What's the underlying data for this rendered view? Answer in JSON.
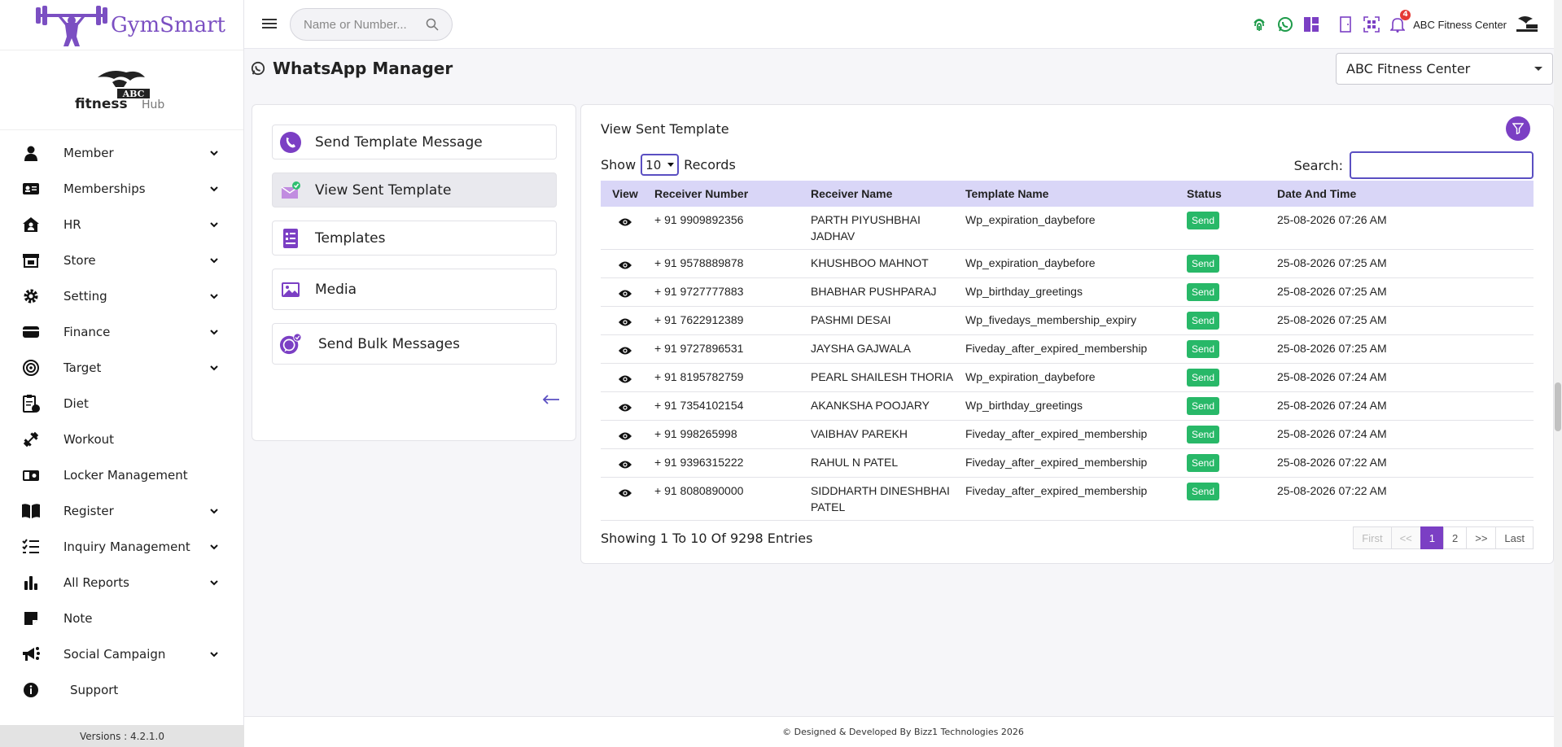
{
  "brand": {
    "name": "GymSmart",
    "gym_logo_text": "ABC fitness Hub"
  },
  "sidebar": {
    "items": [
      {
        "label": "Member",
        "icon": "user-icon",
        "has_children": true
      },
      {
        "label": "Memberships",
        "icon": "id-card-icon",
        "has_children": true
      },
      {
        "label": "HR",
        "icon": "house-user-icon",
        "has_children": true
      },
      {
        "label": "Store",
        "icon": "store-icon",
        "has_children": true
      },
      {
        "label": "Setting",
        "icon": "gear-icon",
        "has_children": true
      },
      {
        "label": "Finance",
        "icon": "credit-card-icon",
        "has_children": true
      },
      {
        "label": "Target",
        "icon": "target-icon",
        "has_children": true
      },
      {
        "label": "Diet",
        "icon": "diet-clipboard-icon",
        "has_children": false
      },
      {
        "label": "Workout",
        "icon": "dumbbell-icon",
        "has_children": false
      },
      {
        "label": "Locker Management",
        "icon": "locker-icon",
        "has_children": false
      },
      {
        "label": "Register",
        "icon": "book-icon",
        "has_children": true
      },
      {
        "label": "Inquiry Management",
        "icon": "checklist-icon",
        "has_children": true
      },
      {
        "label": "All Reports",
        "icon": "bar-chart-icon",
        "has_children": true
      },
      {
        "label": "Note",
        "icon": "note-icon",
        "has_children": false
      },
      {
        "label": "Social Campaign",
        "icon": "megaphone-icon",
        "has_children": true
      },
      {
        "label": "Support",
        "icon": "info-icon",
        "has_children": false
      }
    ],
    "version": "Versions : 4.2.1.0"
  },
  "topbar": {
    "search_placeholder": "Name or Number...",
    "notification_count": "4",
    "gym_name": "ABC Fitness Center"
  },
  "page": {
    "title": "WhatsApp Manager",
    "center_select": "ABC Fitness Center"
  },
  "left_menu": {
    "items": [
      {
        "label": "Send Template Message",
        "icon": "whatsapp-phone-icon"
      },
      {
        "label": "View Sent Template",
        "icon": "envelope-check-icon",
        "active": true
      },
      {
        "label": "Templates",
        "icon": "document-list-icon"
      },
      {
        "label": "Media",
        "icon": "image-icon"
      },
      {
        "label": "Send Bulk Messages",
        "icon": "bulk-whatsapp-icon"
      }
    ]
  },
  "table_panel": {
    "title": "View Sent Template",
    "show_label": "Show",
    "show_value": "10",
    "records_label": "Records",
    "search_label": "Search:",
    "search_value": "",
    "columns": [
      "View",
      "Receiver Number",
      "Receiver Name",
      "Template Name",
      "Status",
      "Date And Time"
    ],
    "rows": [
      {
        "number": "+ 91 9909892356",
        "name": "PARTH PIYUSHBHAI JADHAV",
        "template": "Wp_expiration_daybefore",
        "status": "Send",
        "datetime": "25-08-2026 07:26 AM"
      },
      {
        "number": "+ 91 9578889878",
        "name": "KHUSHBOO MAHNOT",
        "template": "Wp_expiration_daybefore",
        "status": "Send",
        "datetime": "25-08-2026 07:25 AM"
      },
      {
        "number": "+ 91 9727777883",
        "name": "BHABHAR PUSHPARAJ",
        "template": "Wp_birthday_greetings",
        "status": "Send",
        "datetime": "25-08-2026 07:25 AM"
      },
      {
        "number": "+ 91 7622912389",
        "name": "PASHMI DESAI",
        "template": "Wp_fivedays_membership_expiry",
        "status": "Send",
        "datetime": "25-08-2026 07:25 AM"
      },
      {
        "number": "+ 91 9727896531",
        "name": "JAYSHA GAJWALA",
        "template": "Fiveday_after_expired_membership",
        "status": "Send",
        "datetime": "25-08-2026 07:25 AM"
      },
      {
        "number": "+ 91 8195782759",
        "name": "PEARL SHAILESH THORIA",
        "template": "Wp_expiration_daybefore",
        "status": "Send",
        "datetime": "25-08-2026 07:24 AM"
      },
      {
        "number": "+ 91 7354102154",
        "name": "AKANKSHA POOJARY",
        "template": "Wp_birthday_greetings",
        "status": "Send",
        "datetime": "25-08-2026 07:24 AM"
      },
      {
        "number": "+ 91 998265998",
        "name": "VAIBHAV PAREKH",
        "template": "Fiveday_after_expired_membership",
        "status": "Send",
        "datetime": "25-08-2026 07:24 AM"
      },
      {
        "number": "+ 91 9396315222",
        "name": "RAHUL N PATEL",
        "template": "Fiveday_after_expired_membership",
        "status": "Send",
        "datetime": "25-08-2026 07:22 AM"
      },
      {
        "number": "+ 91 8080890000",
        "name": "SIDDHARTH DINESHBHAI PATEL",
        "template": "Fiveday_after_expired_membership",
        "status": "Send",
        "datetime": "25-08-2026 07:22 AM"
      }
    ],
    "showing_text": "Showing 1 To 10 Of 9298 Entries",
    "pagination": [
      {
        "label": "First",
        "state": "disabled"
      },
      {
        "label": "<<",
        "state": "disabled"
      },
      {
        "label": "1",
        "state": "current"
      },
      {
        "label": "2",
        "state": "enabled"
      },
      {
        "label": ">>",
        "state": "enabled"
      },
      {
        "label": "Last",
        "state": "enabled"
      }
    ]
  },
  "footer": {
    "text": "© Designed & Developed By Bizz1 Technologies 2026"
  },
  "colors": {
    "accent": "#7b3fc4",
    "status_send": "#28b868",
    "table_header": "#d9d6f7"
  }
}
